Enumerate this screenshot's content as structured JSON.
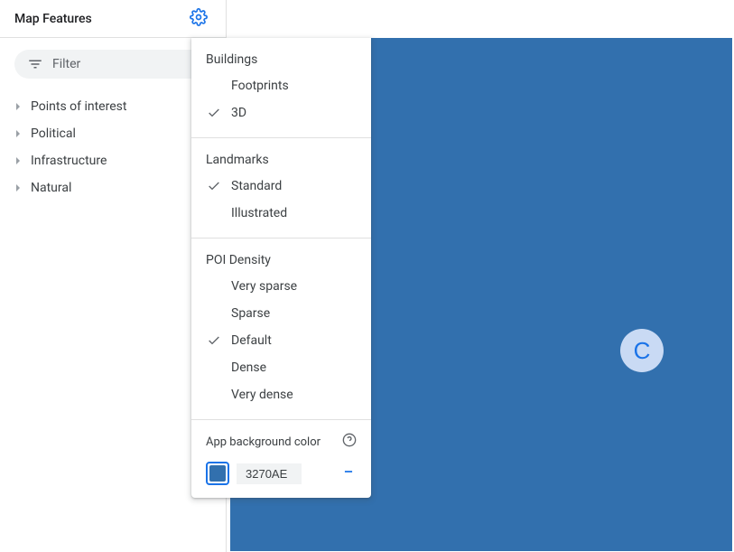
{
  "colors": {
    "accent": "#1a73e8",
    "canvas_bg": "#3270AE"
  },
  "sidebar": {
    "title": "Map Features",
    "filter_placeholder": "Filter",
    "items": [
      {
        "label": "Points of interest"
      },
      {
        "label": "Political"
      },
      {
        "label": "Infrastructure"
      },
      {
        "label": "Natural"
      }
    ]
  },
  "settings_panel": {
    "groups": [
      {
        "title": "Buildings",
        "options": [
          {
            "label": "Footprints",
            "selected": false
          },
          {
            "label": "3D",
            "selected": true
          }
        ]
      },
      {
        "title": "Landmarks",
        "options": [
          {
            "label": "Standard",
            "selected": true
          },
          {
            "label": "Illustrated",
            "selected": false
          }
        ]
      },
      {
        "title": "POI Density",
        "options": [
          {
            "label": "Very sparse",
            "selected": false
          },
          {
            "label": "Sparse",
            "selected": false
          },
          {
            "label": "Default",
            "selected": true
          },
          {
            "label": "Dense",
            "selected": false
          },
          {
            "label": "Very dense",
            "selected": false
          }
        ]
      }
    ],
    "app_bg": {
      "title": "App background color",
      "hex": "3270AE"
    }
  },
  "canvas": {
    "marker_letter": "C"
  }
}
